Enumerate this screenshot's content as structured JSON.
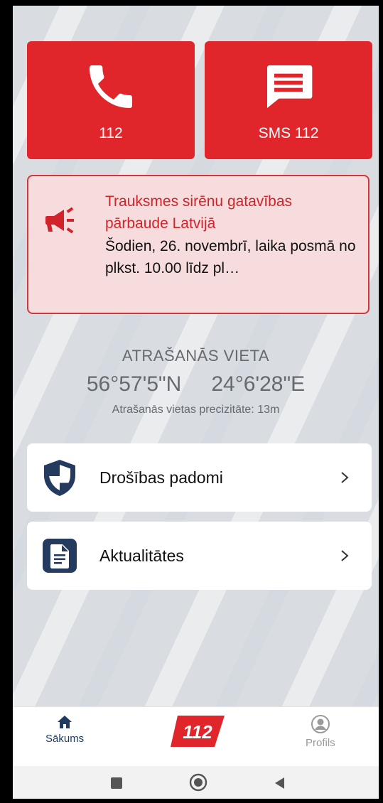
{
  "top_buttons": {
    "call": {
      "label": "112",
      "icon": "phone-icon"
    },
    "sms": {
      "label": "SMS 112",
      "icon": "message-icon"
    }
  },
  "alert": {
    "icon": "megaphone-icon",
    "title": "Trauksmes sirēnu gatavības pārbaude Latvijā",
    "body": "Šodien, 26. novembrī, laika posmā no plkst. 10.00 līdz pl…"
  },
  "location": {
    "title": "ATRAŠANĀS VIETA",
    "lat": "56°57'5\"N",
    "lon": "24°6'28\"E",
    "precision": "Atrašanās vietas precizitāte: 13m"
  },
  "menu": [
    {
      "label": "Drošības padomi",
      "icon": "shield-icon"
    },
    {
      "label": "Aktualitātes",
      "icon": "document-icon"
    }
  ],
  "bottom_nav": {
    "home": {
      "label": "Sākums",
      "icon": "home-icon"
    },
    "logo": {
      "text": "112"
    },
    "profile": {
      "label": "Profils",
      "icon": "profile-icon"
    }
  },
  "system_nav": [
    "square-icon",
    "circle-home-icon",
    "back-triangle-icon"
  ],
  "colors": {
    "brand_red": "#e1262b",
    "alert_bg": "#f6dcdc",
    "navy": "#243a5e"
  }
}
